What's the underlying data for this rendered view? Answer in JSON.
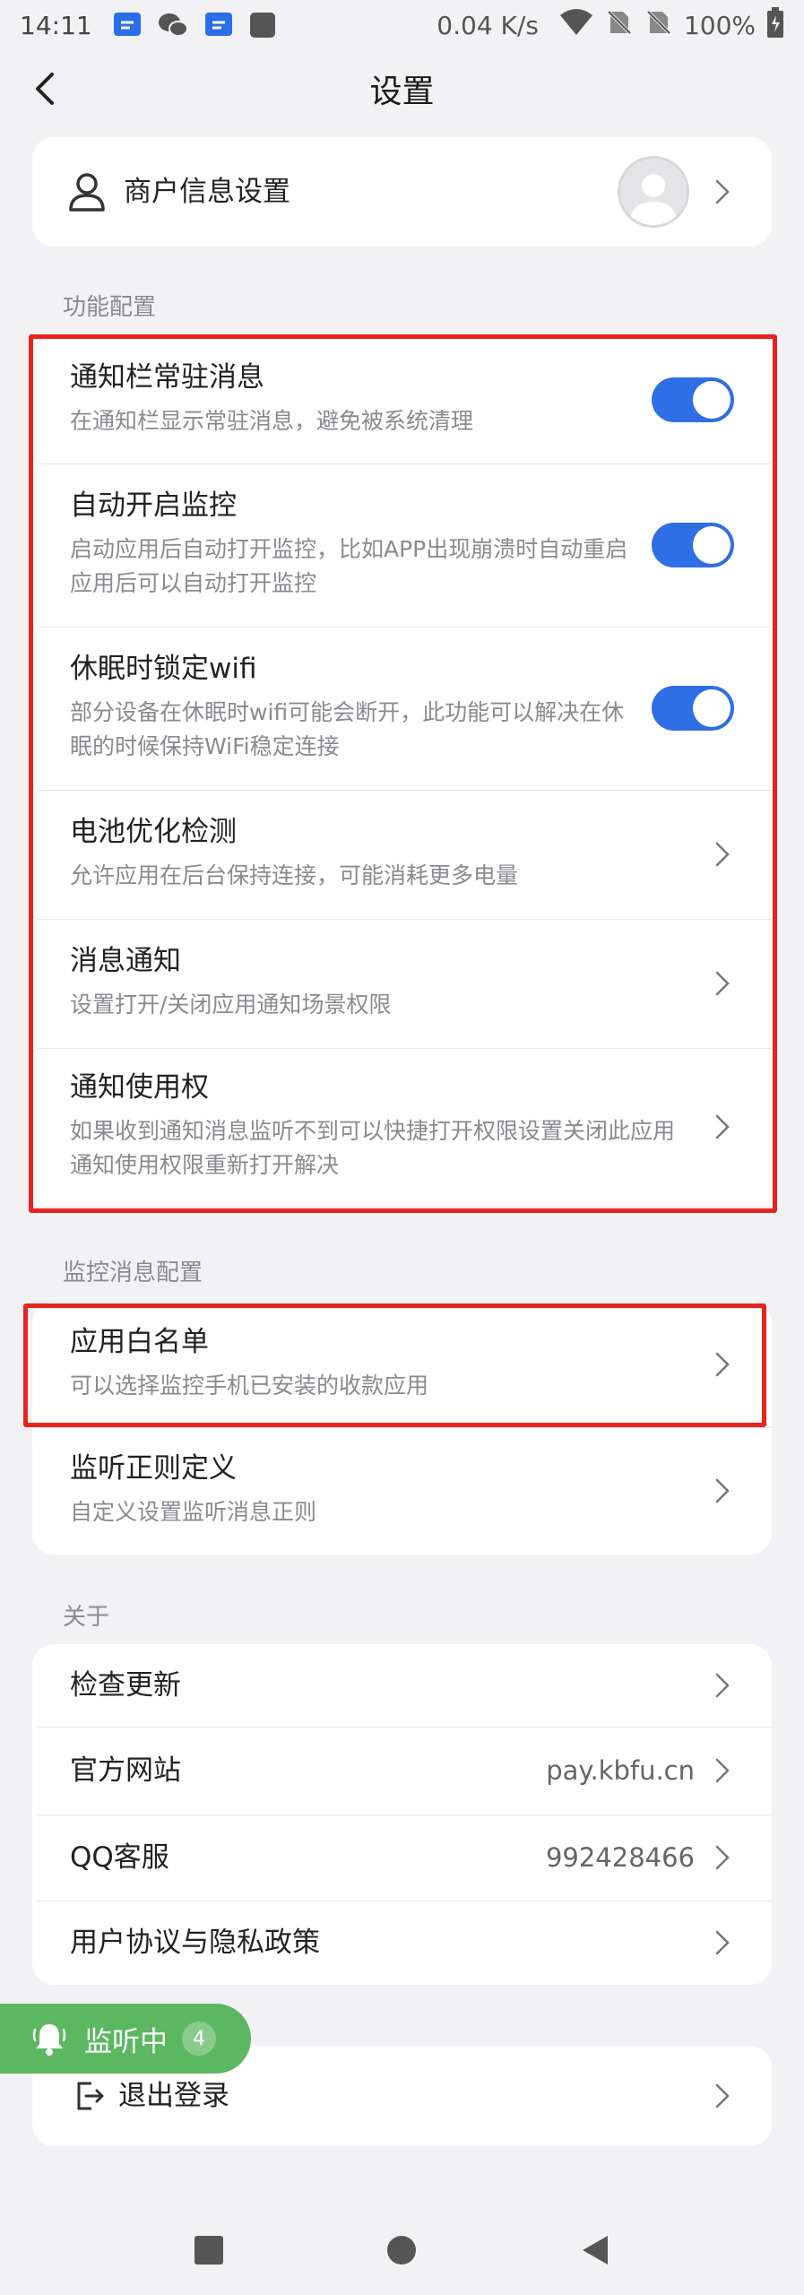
{
  "status_bar": {
    "time": "14:11",
    "speed": "0.04 K/s",
    "battery": "100%"
  },
  "header": {
    "title": "设置"
  },
  "merchant": {
    "label": "商户信息设置"
  },
  "sections": {
    "function_config": "功能配置",
    "monitor_config": "监控消息配置",
    "about": "关于"
  },
  "function_items": [
    {
      "title": "通知栏常驻消息",
      "desc": "在通知栏显示常驻消息，避免被系统清理",
      "toggle": true
    },
    {
      "title": "自动开启监控",
      "desc": "启动应用后自动打开监控，比如APP出现崩溃时自动重启应用后可以自动打开监控",
      "toggle": true
    },
    {
      "title": "休眠时锁定wifi",
      "desc": "部分设备在休眠时wifi可能会断开，此功能可以解决在休眠的时候保持WiFi稳定连接",
      "toggle": true
    },
    {
      "title": "电池优化检测",
      "desc": "允许应用在后台保持连接，可能消耗更多电量"
    },
    {
      "title": "消息通知",
      "desc": "设置打开/关闭应用通知场景权限"
    },
    {
      "title": "通知使用权",
      "desc": "如果收到通知消息监听不到可以快捷打开权限设置关闭此应用通知使用权限重新打开解决"
    }
  ],
  "monitor_items": [
    {
      "title": "应用白名单",
      "desc": "可以选择监控手机已安装的收款应用"
    },
    {
      "title": "监听正则定义",
      "desc": "自定义设置监听消息正则"
    }
  ],
  "about_items": [
    {
      "title": "检查更新",
      "value": ""
    },
    {
      "title": "官方网站",
      "value": "pay.kbfu.cn"
    },
    {
      "title": "QQ客服",
      "value": "992428466"
    },
    {
      "title": "用户协议与隐私政策",
      "value": ""
    }
  ],
  "logout": {
    "label": "退出登录"
  },
  "monitor_badge": {
    "label": "监听中",
    "count": "4"
  },
  "colors": {
    "toggle_on": "#2f6fe6",
    "highlight": "#e8231f",
    "monitor_pill": "#5cb860"
  }
}
